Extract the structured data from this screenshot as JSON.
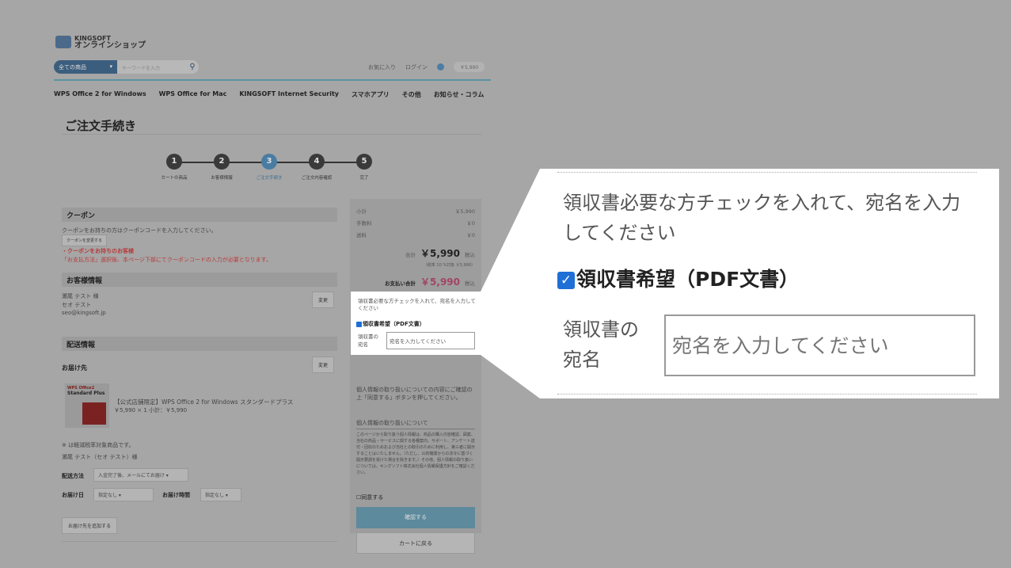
{
  "header": {
    "logo_top": "KINGSOFT",
    "logo_bottom": "オンラインショップ",
    "category": "全ての商品",
    "search_placeholder": "キーワードを入力",
    "favorites": "お気に入り",
    "login": "ログイン",
    "cart_total": "￥5,990"
  },
  "nav": [
    "WPS Office 2 for Windows",
    "WPS Office for Mac",
    "KINGSOFT Internet Security",
    "スマホアプリ",
    "その他",
    "お知らせ・コラム"
  ],
  "page_title": "ご注文手続き",
  "steps": [
    {
      "num": "1",
      "label": "カートの商品"
    },
    {
      "num": "2",
      "label": "お客様情報"
    },
    {
      "num": "3",
      "label": "ご注文手続き"
    },
    {
      "num": "4",
      "label": "ご注文内容確認"
    },
    {
      "num": "5",
      "label": "完了"
    }
  ],
  "coupon": {
    "heading": "クーポン",
    "desc": "クーポンをお持ちの方はクーポンコードを入力してください。",
    "change_btn": "クーポンを変更する",
    "notice_title": "・クーポンをお持ちのお客様",
    "notice_text": "「お支払方法」選択後、本ページ下部にてクーポンコードの入力が必要となります。"
  },
  "customer": {
    "heading": "お客様情報",
    "name": "瀬尾 テスト 様",
    "kana": "セオ テスト",
    "email": "seo@kingsoft.jp",
    "change_btn": "変更"
  },
  "shipping": {
    "heading": "配送情報",
    "dest_label": "お届け先",
    "change_btn": "変更",
    "product_box_brand": "WPS Office2",
    "product_box_name": "Standard Plus",
    "product_name": "【公式店舗限定】WPS Office 2 for Windows スタンダードプラス",
    "product_price": "￥5,990 × 1  小計：￥5,990",
    "tax_note": "※ は軽減税率対象商品です。",
    "recipient": "瀬尾 テスト（セオ テスト）様",
    "method_label": "配送方法",
    "method_value": "入金完了後、メールにてお届け",
    "date_label": "お届け日",
    "date_value": "指定なし",
    "time_label": "お届け時間",
    "time_value": "指定なし",
    "add_btn": "お届け先を追加する"
  },
  "summary": {
    "subtotal_label": "小計",
    "subtotal": "￥5,990",
    "fee_label": "手数料",
    "fee": "￥0",
    "shipping_label": "送料",
    "shipping": "￥0",
    "total_label": "合計",
    "total": "￥5,990",
    "tax_in": "税込",
    "tax_detail": "（税率 10 %対象  ￥5,990）",
    "pay_label": "お支払い合計",
    "pay": "￥5,990",
    "privacy_text": "個人情報の取り扱いについての内容にご確認の上「同意する」ボタンを押してください。",
    "privacy_heading": "個人情報の取り扱いについて",
    "privacy_body": "このページから取り扱う個人情報は、商品の購入内容確認、図案、当社の商品・サービスに関する各種案内、サポート、アンケート送付・回収のためおよび当社との取引のために利用し、第三者に開示することはいたしません。（ただし、公的機関からの法令に基づく開示要請を受けた場合を除きます。）その他、個人情報の取り扱いについては、キングソフト株式会社個人情報保護方針をご確認ください。",
    "agree": "同意する",
    "confirm_btn": "確認する",
    "back_btn": "カートに戻る"
  },
  "receipt": {
    "instruction": "領収書必要な方チェックを入れて、宛名を入力してください",
    "checkbox_label": "領収書希望（PDF文書）",
    "checked": true,
    "addressee_label": "領収書の宛名",
    "addressee_label_line1": "領収書の",
    "addressee_label_line2": "宛名",
    "addressee_placeholder": "宛名を入力してください"
  },
  "colors": {
    "highlight_check": "#1e6fd6",
    "accent": "#4a7ca2",
    "price": "#a24465"
  }
}
